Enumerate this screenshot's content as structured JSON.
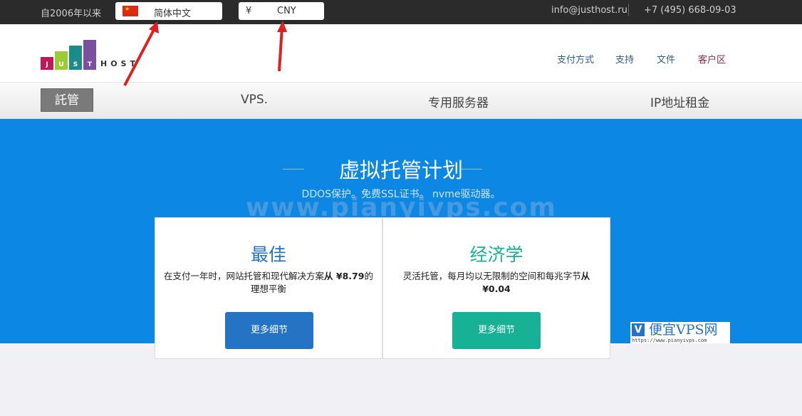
{
  "topbar": {
    "since": "自2006年以来",
    "language": "简体中文",
    "currency_symbol": "¥",
    "currency": "CNY",
    "email": "info@justhost.ru",
    "phone": "+7 (495) 668-09-03"
  },
  "logo": {
    "letters": [
      "J",
      "U",
      "S",
      "T"
    ],
    "host": "HOST",
    "colors": [
      "#c2185b",
      "#9acd32",
      "#1a8c8c",
      "#7b4fa0"
    ]
  },
  "nav": {
    "payment": "支付方式",
    "support": "支持",
    "docs": "文件",
    "client_area": "客户区"
  },
  "tabs": {
    "hosting": "託管",
    "vps": "VPS.",
    "dedicated": "专用服务器",
    "ip_rent": "IP地址租金"
  },
  "hero": {
    "title": "虚拟托管计划",
    "subtitle": "DDOS保护。免费SSL证书。 nvme驱动器。",
    "watermark": "www.pianyivps.com"
  },
  "cards": [
    {
      "title": "最佳",
      "desc": "在支付一年时，网站托管和现代解决方案",
      "desc_bold": "从 ¥8.79",
      "desc_end": "的理想平衡",
      "button": "更多细节",
      "color": "#2473c4"
    },
    {
      "title": "经济学",
      "desc": "灵活托管，每月均以无限制的空间和每兆字节",
      "desc_bold": "从 ¥0.04",
      "desc_end": "",
      "button": "更多细节",
      "color": "#17b196"
    }
  ],
  "badge": {
    "v": "V",
    "name": "便宜VPS网",
    "url": "https://www.pianyivps.com"
  },
  "colors": {
    "hero_bg": "#0d87e4",
    "topbar_bg": "#2b2b2b",
    "arrow": "#e02020"
  }
}
